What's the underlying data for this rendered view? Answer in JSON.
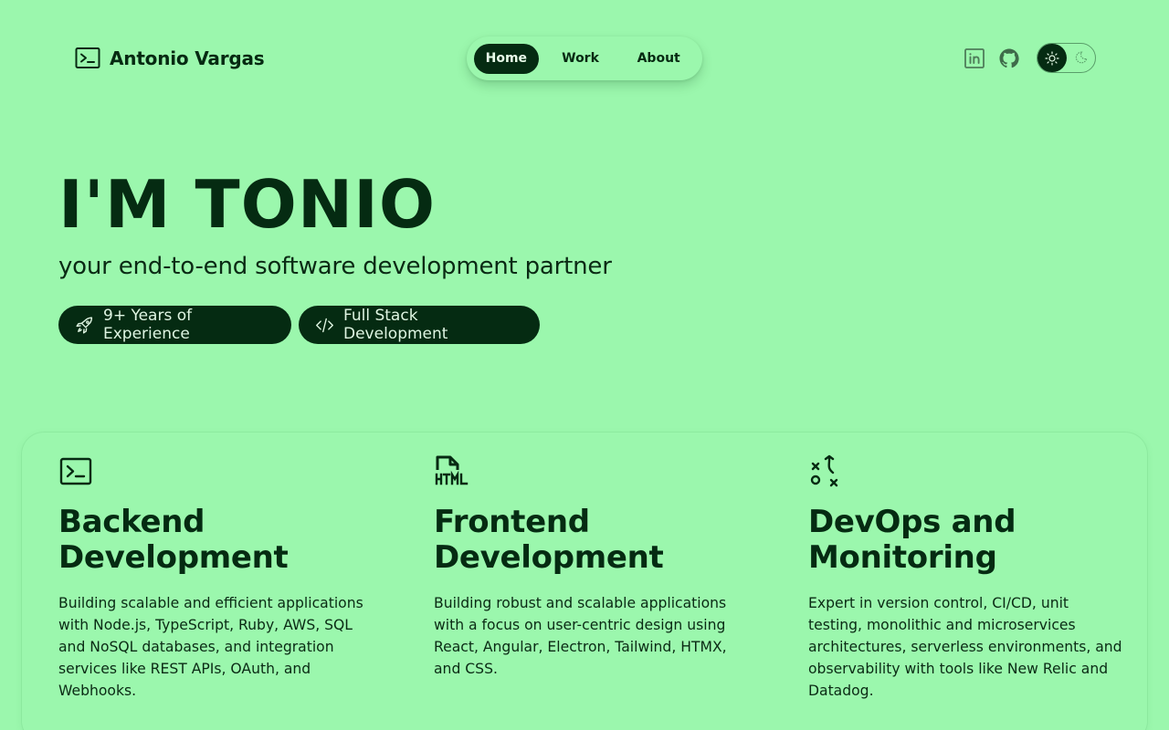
{
  "header": {
    "brand_name": "Antonio Vargas",
    "brand_icon": "terminal-icon",
    "nav": [
      {
        "label": "Home",
        "active": true
      },
      {
        "label": "Work",
        "active": false
      },
      {
        "label": "About",
        "active": false
      }
    ],
    "social": [
      "linkedin-icon",
      "github-icon"
    ],
    "theme": {
      "current": "light",
      "icons": [
        "sun-icon",
        "moon-icon"
      ]
    }
  },
  "hero": {
    "title": "I'M TONIO",
    "subtitle": "your end-to-end software development partner",
    "badges": [
      {
        "icon": "rocket-icon",
        "label": "9+ Years of Experience"
      },
      {
        "icon": "code-icon",
        "label": "Full Stack Development"
      }
    ]
  },
  "features": [
    {
      "icon": "terminal-icon",
      "title": "Backend Development",
      "title_lines": [
        "Backend",
        "Development"
      ],
      "text": "Building scalable and efficient applications with Node.js, TypeScript, Ruby, AWS, SQL and NoSQL databases, and integration services like REST APIs, OAuth, and Webhooks."
    },
    {
      "icon": "html-file-icon",
      "title": "Frontend Development",
      "title_lines": [
        "Frontend",
        "Development"
      ],
      "text": "Building robust and scalable applications with a focus on user-centric design using React, Angular, Electron, Tailwind, HTMX, and CSS."
    },
    {
      "icon": "strategy-icon",
      "title": "DevOps and Monitoring",
      "title_lines": [
        "DevOps and",
        "Monitoring"
      ],
      "text": "Expert in version control, CI/CD, unit testing, monolithic and microservices architectures, serverless environments, and observability with tools like New Relic and Datadog."
    }
  ],
  "colors": {
    "background": "#9bf7ad",
    "primary_dark": "#052b12",
    "text": "#062a12",
    "pill_text": "#dff5e2"
  }
}
